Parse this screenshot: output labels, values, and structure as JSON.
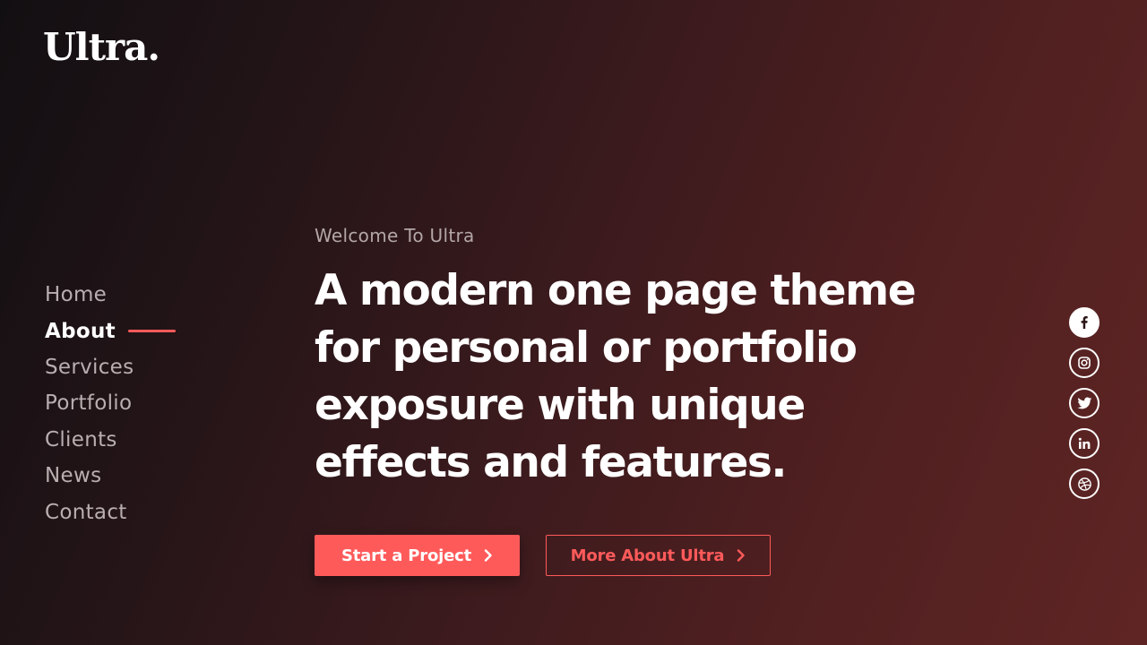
{
  "brand": {
    "logo": "Ultra."
  },
  "nav": {
    "items": [
      {
        "label": "Home",
        "active": false
      },
      {
        "label": "About",
        "active": true
      },
      {
        "label": "Services",
        "active": false
      },
      {
        "label": "Portfolio",
        "active": false
      },
      {
        "label": "Clients",
        "active": false
      },
      {
        "label": "News",
        "active": false
      },
      {
        "label": "Contact",
        "active": false
      }
    ]
  },
  "hero": {
    "eyebrow": "Welcome To Ultra",
    "headline_lines": [
      "A modern one page theme",
      "for personal or portfolio",
      "exposure with unique",
      "effects and features."
    ]
  },
  "buttons": {
    "primary_label": "Start a Project",
    "secondary_label": "More About Ultra"
  },
  "social": [
    "facebook-icon",
    "instagram-icon",
    "twitter-icon",
    "linkedin-icon",
    "dribbble-icon"
  ],
  "colors": {
    "accent": "#ff5a5a",
    "text": "#ffffff",
    "muted": "#b9aeb0"
  }
}
